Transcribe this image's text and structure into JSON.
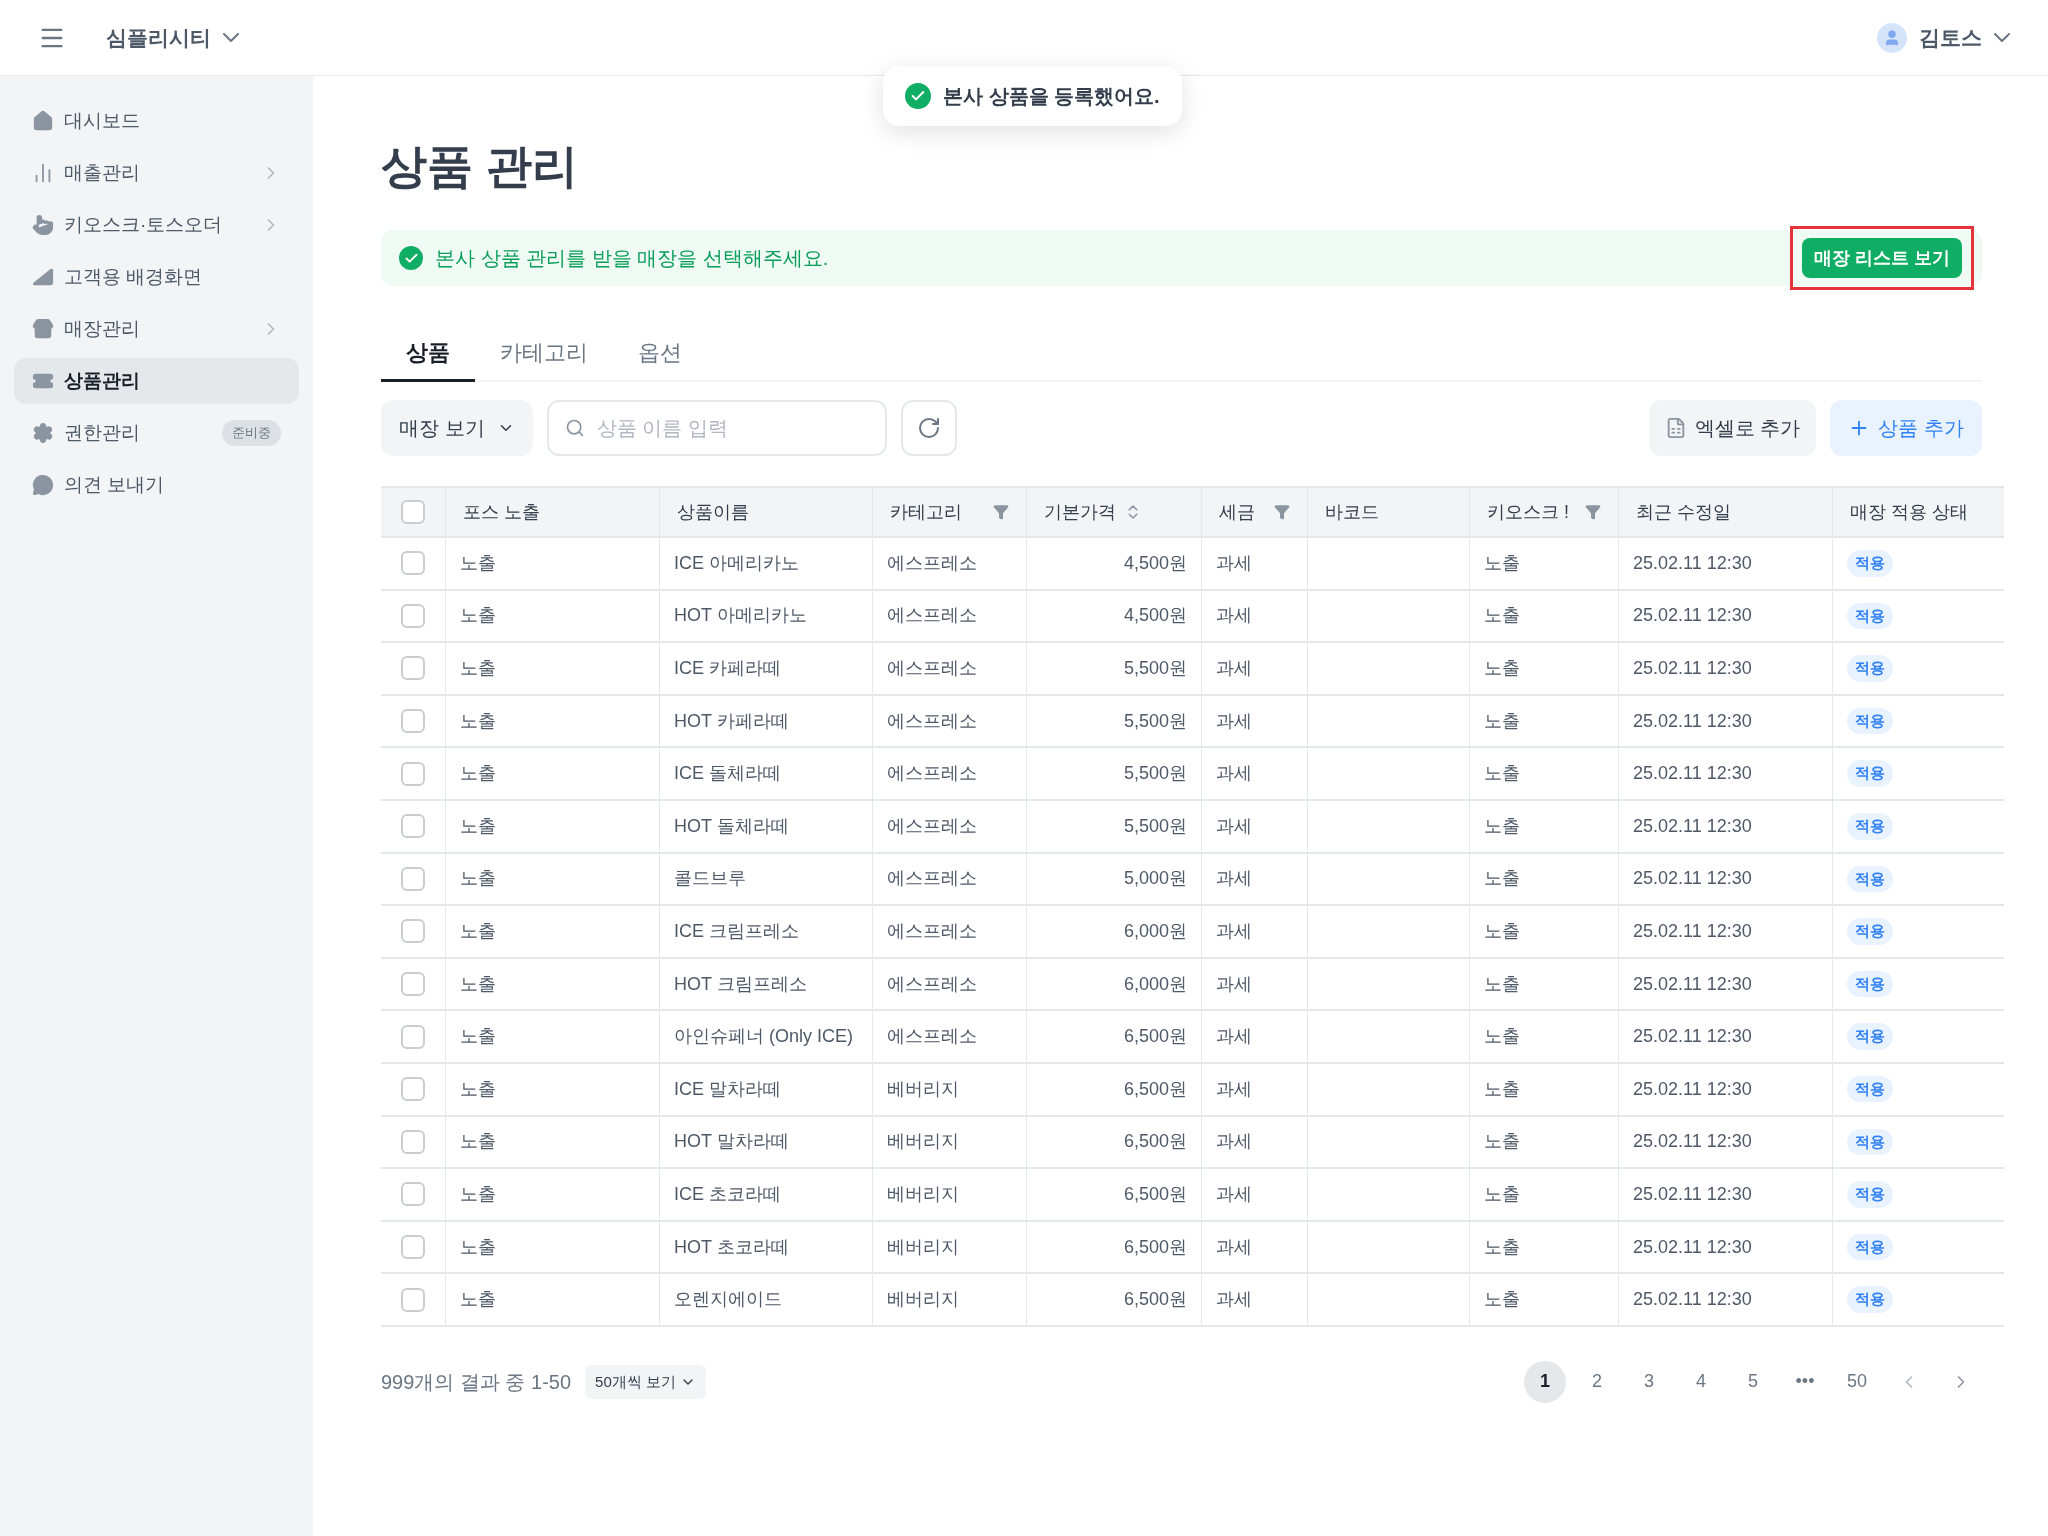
{
  "header": {
    "workspace": "심플리시티",
    "user": "김토스"
  },
  "toast": {
    "message": "본사 상품을 등록했어요."
  },
  "sidebar": {
    "items": [
      {
        "label": "대시보드",
        "expandable": false,
        "selected": false
      },
      {
        "label": "매출관리",
        "expandable": true,
        "selected": false
      },
      {
        "label": "키오스크·토스오더",
        "expandable": true,
        "selected": false
      },
      {
        "label": "고객용 배경화면",
        "expandable": false,
        "selected": false
      },
      {
        "label": "매장관리",
        "expandable": true,
        "selected": false
      },
      {
        "label": "상품관리",
        "expandable": false,
        "selected": true
      },
      {
        "label": "권한관리",
        "expandable": false,
        "selected": false,
        "badge": "준비중"
      },
      {
        "label": "의견 보내기",
        "expandable": false,
        "selected": false
      }
    ]
  },
  "page": {
    "title": "상품 관리"
  },
  "banner": {
    "message": "본사 상품 관리를 받을 매장을 선택해주세요.",
    "button": "매장 리스트 보기",
    "highlighted": true
  },
  "tabs": [
    {
      "label": "상품",
      "selected": true
    },
    {
      "label": "카테고리",
      "selected": false
    },
    {
      "label": "옵션",
      "selected": false
    }
  ],
  "toolbar": {
    "store_filter": "매장 보기",
    "search": {
      "placeholder": "상품 이름 입력"
    },
    "excel_button": "엑셀로 추가",
    "add_button": "상품 추가"
  },
  "table": {
    "all_checked": false,
    "columns": [
      {
        "label": "포스 노출",
        "kind": "plain"
      },
      {
        "label": "상품이름",
        "kind": "plain"
      },
      {
        "label": "카테고리",
        "kind": "filter"
      },
      {
        "label": "기본가격",
        "kind": "sort"
      },
      {
        "label": "세금",
        "kind": "filter"
      },
      {
        "label": "바코드",
        "kind": "plain"
      },
      {
        "label": "키오스크 !",
        "kind": "filter"
      },
      {
        "label": "최근 수정일",
        "kind": "plain"
      },
      {
        "label": "매장 적용 상태",
        "kind": "plain"
      }
    ],
    "rows": [
      {
        "checked": false,
        "pos": "노출",
        "name": "ICE 아메리카노",
        "category": "에스프레소",
        "price": "4,500원",
        "tax": "과세",
        "kiosk": "노출",
        "updated": "25.02.11 12:30",
        "status": "적용"
      },
      {
        "checked": false,
        "pos": "노출",
        "name": "HOT 아메리카노",
        "category": "에스프레소",
        "price": "4,500원",
        "tax": "과세",
        "kiosk": "노출",
        "updated": "25.02.11 12:30",
        "status": "적용"
      },
      {
        "checked": false,
        "pos": "노출",
        "name": "ICE 카페라떼",
        "category": "에스프레소",
        "price": "5,500원",
        "tax": "과세",
        "kiosk": "노출",
        "updated": "25.02.11 12:30",
        "status": "적용"
      },
      {
        "checked": false,
        "pos": "노출",
        "name": "HOT 카페라떼",
        "category": "에스프레소",
        "price": "5,500원",
        "tax": "과세",
        "kiosk": "노출",
        "updated": "25.02.11 12:30",
        "status": "적용"
      },
      {
        "checked": false,
        "pos": "노출",
        "name": "ICE 돌체라떼",
        "category": "에스프레소",
        "price": "5,500원",
        "tax": "과세",
        "kiosk": "노출",
        "updated": "25.02.11 12:30",
        "status": "적용"
      },
      {
        "checked": false,
        "pos": "노출",
        "name": "HOT 돌체라떼",
        "category": "에스프레소",
        "price": "5,500원",
        "tax": "과세",
        "kiosk": "노출",
        "updated": "25.02.11 12:30",
        "status": "적용"
      },
      {
        "checked": false,
        "pos": "노출",
        "name": "콜드브루",
        "category": "에스프레소",
        "price": "5,000원",
        "tax": "과세",
        "kiosk": "노출",
        "updated": "25.02.11 12:30",
        "status": "적용"
      },
      {
        "checked": false,
        "pos": "노출",
        "name": "ICE 크림프레소",
        "category": "에스프레소",
        "price": "6,000원",
        "tax": "과세",
        "kiosk": "노출",
        "updated": "25.02.11 12:30",
        "status": "적용"
      },
      {
        "checked": false,
        "pos": "노출",
        "name": "HOT 크림프레소",
        "category": "에스프레소",
        "price": "6,000원",
        "tax": "과세",
        "kiosk": "노출",
        "updated": "25.02.11 12:30",
        "status": "적용"
      },
      {
        "checked": false,
        "pos": "노출",
        "name": "아인슈페너 (Only ICE)",
        "category": "에스프레소",
        "price": "6,500원",
        "tax": "과세",
        "kiosk": "노출",
        "updated": "25.02.11 12:30",
        "status": "적용"
      },
      {
        "checked": false,
        "pos": "노출",
        "name": "ICE 말차라떼",
        "category": "베버리지",
        "price": "6,500원",
        "tax": "과세",
        "kiosk": "노출",
        "updated": "25.02.11 12:30",
        "status": "적용"
      },
      {
        "checked": false,
        "pos": "노출",
        "name": "HOT 말차라떼",
        "category": "베버리지",
        "price": "6,500원",
        "tax": "과세",
        "kiosk": "노출",
        "updated": "25.02.11 12:30",
        "status": "적용"
      },
      {
        "checked": false,
        "pos": "노출",
        "name": "ICE 초코라떼",
        "category": "베버리지",
        "price": "6,500원",
        "tax": "과세",
        "kiosk": "노출",
        "updated": "25.02.11 12:30",
        "status": "적용"
      },
      {
        "checked": false,
        "pos": "노출",
        "name": "HOT 초코라떼",
        "category": "베버리지",
        "price": "6,500원",
        "tax": "과세",
        "kiosk": "노출",
        "updated": "25.02.11 12:30",
        "status": "적용"
      },
      {
        "checked": false,
        "pos": "노출",
        "name": "오렌지에이드",
        "category": "베버리지",
        "price": "6,500원",
        "tax": "과세",
        "kiosk": "노출",
        "updated": "25.02.11 12:30",
        "status": "적용"
      }
    ]
  },
  "pagination": {
    "summary": "999개의 결과 중 1-50",
    "page_size": "50개씩 보기",
    "pages": [
      {
        "label": "1",
        "selected": true
      },
      {
        "label": "2",
        "selected": false
      },
      {
        "label": "3",
        "selected": false
      },
      {
        "label": "4",
        "selected": false
      },
      {
        "label": "5",
        "selected": false
      },
      {
        "label": "•••",
        "selected": false
      },
      {
        "label": "50",
        "selected": false
      }
    ]
  }
}
